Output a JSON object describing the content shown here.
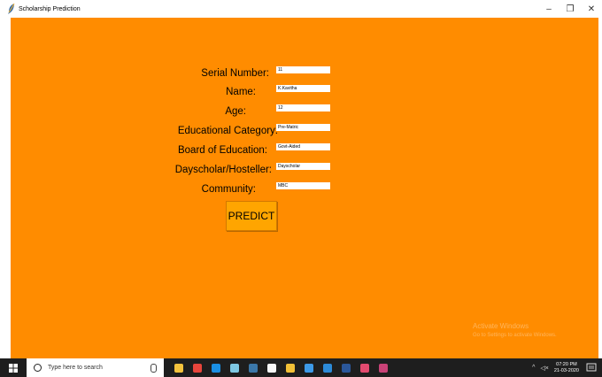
{
  "window": {
    "title": "Scholarship Prediction",
    "controls": {
      "minimize": "–",
      "maximize": "❐",
      "close": "✕"
    }
  },
  "form": {
    "fields": [
      {
        "label": "Serial Number:",
        "value": "11"
      },
      {
        "label": "Name:",
        "value": "K.Kavitha"
      },
      {
        "label": "Age:",
        "value": "12"
      },
      {
        "label": "Educational Category:",
        "value": "Pre-Matric"
      },
      {
        "label": "Board of Education:",
        "value": "Govt-Aided"
      },
      {
        "label": "Dayscholar/Hosteller:",
        "value": "Dayscholar"
      },
      {
        "label": "Community:",
        "value": "MBC"
      }
    ],
    "predict_label": "PREDICT"
  },
  "watermark": {
    "title": "Activate Windows",
    "subtitle": "Go to Settings to activate Windows."
  },
  "taskbar": {
    "search_placeholder": "Type here to search",
    "clock_time": "07:20 PM",
    "clock_date": "21-03-2020",
    "icons": [
      {
        "name": "file-explorer-icon",
        "color": "#f4c33d"
      },
      {
        "name": "chrome-icon",
        "color": "#e8453c"
      },
      {
        "name": "edge-icon",
        "color": "#1a8fe3"
      },
      {
        "name": "notepad-icon",
        "color": "#7ec8e3"
      },
      {
        "name": "python-icon",
        "color": "#3b77a8"
      },
      {
        "name": "paint-icon",
        "color": "#f7f7f7"
      },
      {
        "name": "store-icon",
        "color": "#f2c037"
      },
      {
        "name": "dropbox-icon",
        "color": "#3d9ae8"
      },
      {
        "name": "media-icon",
        "color": "#2c8ad8"
      },
      {
        "name": "word-icon",
        "color": "#2b579a"
      },
      {
        "name": "settings-gear-icon",
        "color": "#e34a6f"
      },
      {
        "name": "tk-app-icon",
        "color": "#c94277"
      }
    ]
  },
  "colors": {
    "background": "#ff8c00",
    "button": "#ffa500",
    "taskbar": "#1e1e1e"
  }
}
